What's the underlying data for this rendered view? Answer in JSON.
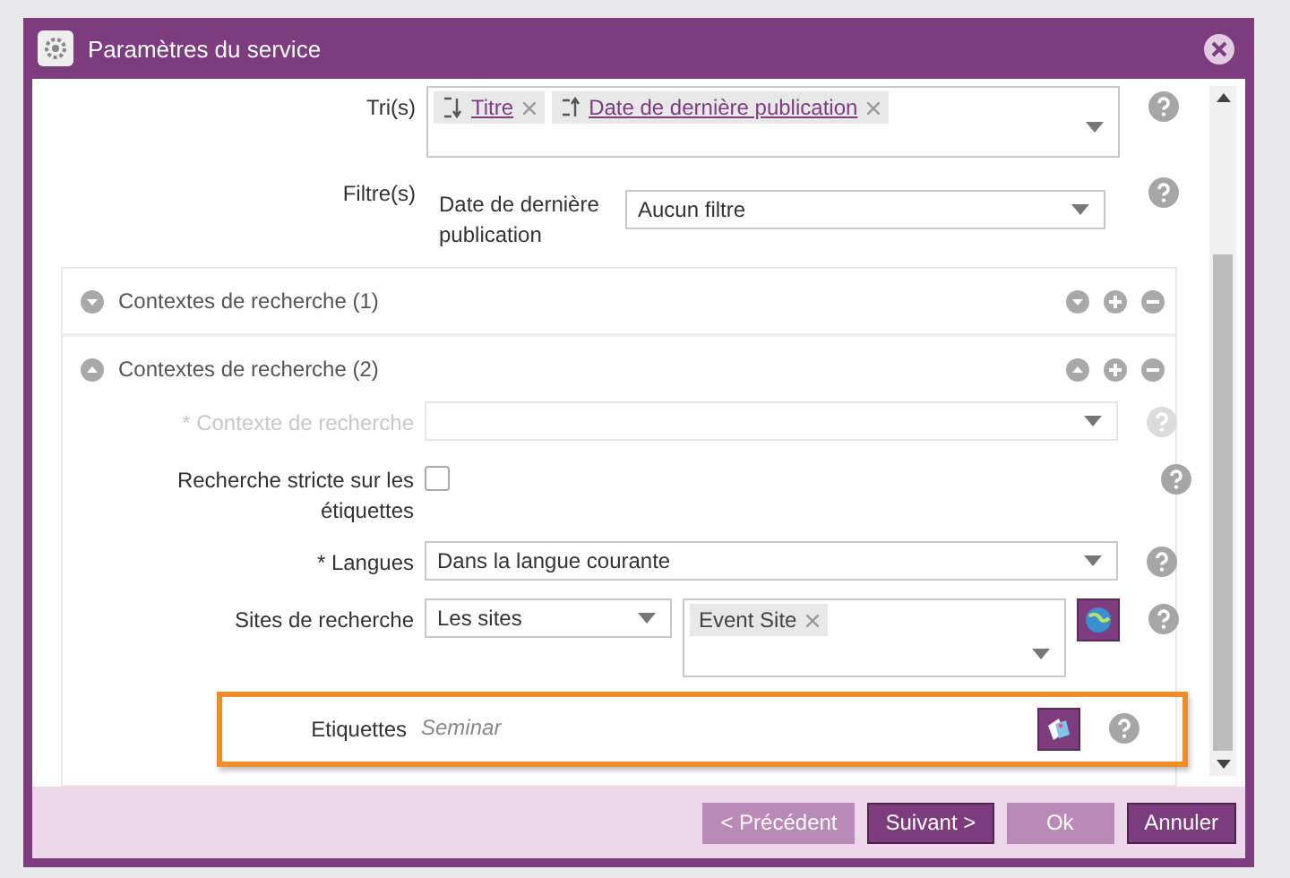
{
  "window": {
    "title": "Paramètres du service"
  },
  "sorts": {
    "label": "Tri(s)",
    "tags": [
      {
        "kind": "alpha",
        "text": "Titre"
      },
      {
        "kind": "date",
        "text": "Date de dernière publication"
      }
    ]
  },
  "filters": {
    "label": "Filtre(s)",
    "field_label": "Date de dernière publication",
    "value": "Aucun filtre"
  },
  "sections": [
    {
      "title": "Contextes de recherche (1)",
      "expanded": false
    },
    {
      "title": "Contextes de recherche (2)",
      "expanded": true
    }
  ],
  "context": {
    "label": "* Contexte de recherche",
    "disabled": true
  },
  "strict": {
    "label": "Recherche stricte sur les étiquettes",
    "checked": false
  },
  "languages": {
    "label": "* Langues",
    "value": "Dans la langue courante"
  },
  "sites": {
    "label": "Sites de recherche",
    "value": "Les sites",
    "tags": [
      "Event Site"
    ]
  },
  "tags_field": {
    "label": "Etiquettes",
    "placeholder": "Seminar",
    "highlighted": true
  },
  "buttons": [
    {
      "label": "< Précédent",
      "disabled": true
    },
    {
      "label": "Suivant >",
      "disabled": false
    },
    {
      "label": "Ok",
      "disabled": true
    },
    {
      "label": "Annuler",
      "disabled": false
    }
  ]
}
